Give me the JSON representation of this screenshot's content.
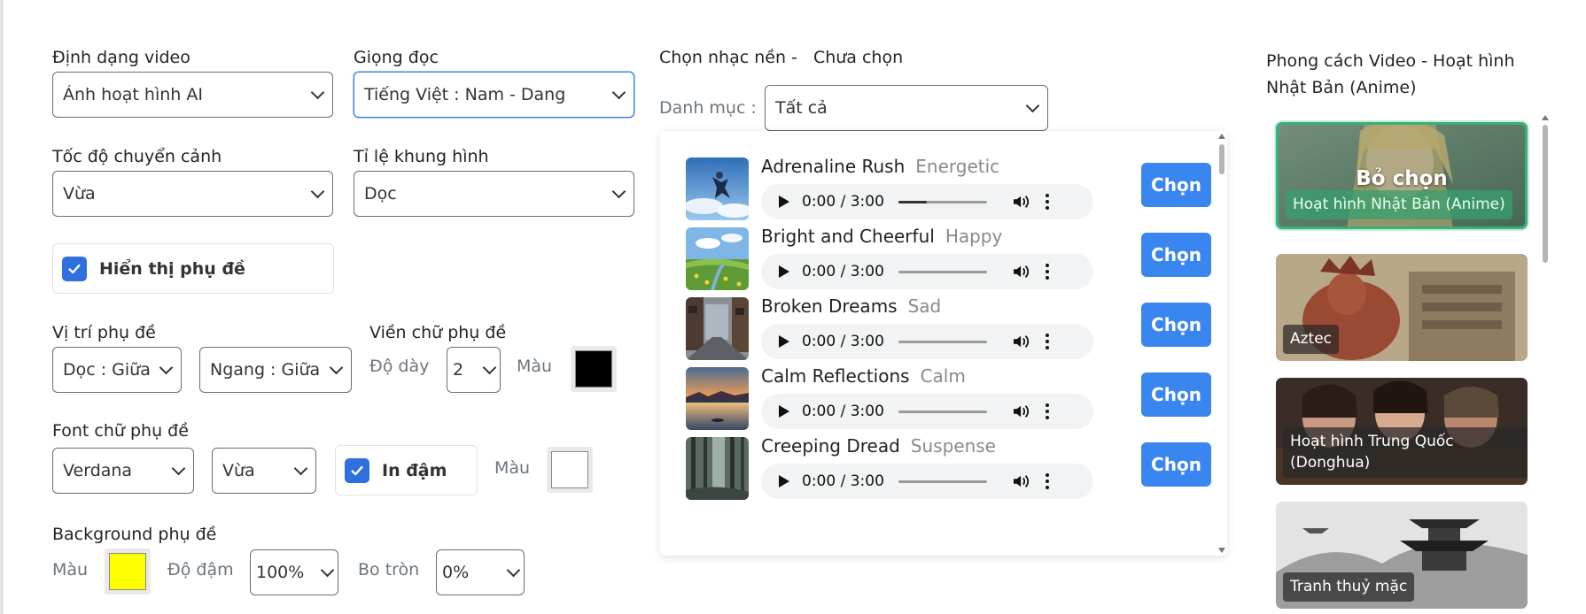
{
  "form": {
    "video_format": {
      "label": "Định dạng video",
      "value": "Ảnh hoạt hình AI"
    },
    "voice": {
      "label": "Giọng đọc",
      "value": "Tiếng Việt : Nam - Dang"
    },
    "transition_speed": {
      "label": "Tốc độ chuyển cảnh",
      "value": "Vừa"
    },
    "aspect_ratio": {
      "label": "Tỉ lệ khung hình",
      "value": "Dọc"
    },
    "show_subtitles": {
      "label": "Hiển thị phụ đề",
      "checked": true
    },
    "subtitle_position": {
      "label": "Vị trí phụ đề",
      "vertical": "Dọc : Giữa",
      "horizontal": "Ngang : Giữa"
    },
    "subtitle_outline": {
      "label": "Viền chữ phụ đề",
      "thickness_label": "Độ dày",
      "thickness": "2",
      "color_label": "Màu",
      "color": "#000000"
    },
    "subtitle_font": {
      "label": "Font chữ phụ đề",
      "family": "Verdana",
      "size": "Vừa",
      "bold_label": "In đậm",
      "bold": true,
      "color_label": "Màu",
      "color": "#ffffff"
    },
    "subtitle_background": {
      "label": "Background phụ đề",
      "color_label": "Màu",
      "color": "#ffff00",
      "opacity_label": "Độ đậm",
      "opacity": "100%",
      "radius_label": "Bo tròn",
      "radius": "0%"
    }
  },
  "music": {
    "title": "Chọn nhạc nền -",
    "selected": "Chưa chọn",
    "category_label": "Danh mục :",
    "category": "Tất cả",
    "choose_label": "Chọn",
    "tracks": [
      {
        "name": "Adrenaline Rush",
        "mood": "Energetic",
        "time": "0:00 / 3:00",
        "progress": 0.32,
        "thumb": "skydiver"
      },
      {
        "name": "Bright and Cheerful",
        "mood": "Happy",
        "time": "0:00 / 3:00",
        "progress": 0.0,
        "thumb": "meadow"
      },
      {
        "name": "Broken Dreams",
        "mood": "Sad",
        "time": "0:00 / 3:00",
        "progress": 0.0,
        "thumb": "street"
      },
      {
        "name": "Calm Reflections",
        "mood": "Calm",
        "time": "0:00 / 3:00",
        "progress": 0.0,
        "thumb": "lake-sunset"
      },
      {
        "name": "Creeping Dread",
        "mood": "Suspense",
        "time": "0:00 / 3:00",
        "progress": 0.0,
        "thumb": "dark-forest"
      }
    ]
  },
  "styles": {
    "title": "Phong cách Video - Hoạt hình Nhật Bản (Anime)",
    "deselect_label": "Bỏ chọn",
    "items": [
      {
        "name": "Hoạt hình Nhật Bản (Anime)",
        "active": true
      },
      {
        "name": "Aztec",
        "active": false
      },
      {
        "name": "Hoạt hình Trung Quốc (Donghua)",
        "active": false
      },
      {
        "name": "Tranh thuỷ mặc",
        "active": false
      }
    ]
  },
  "colors": {
    "accent": "#3a86f0",
    "checkbox": "#2f6fde",
    "active_style": "#37b07a"
  }
}
